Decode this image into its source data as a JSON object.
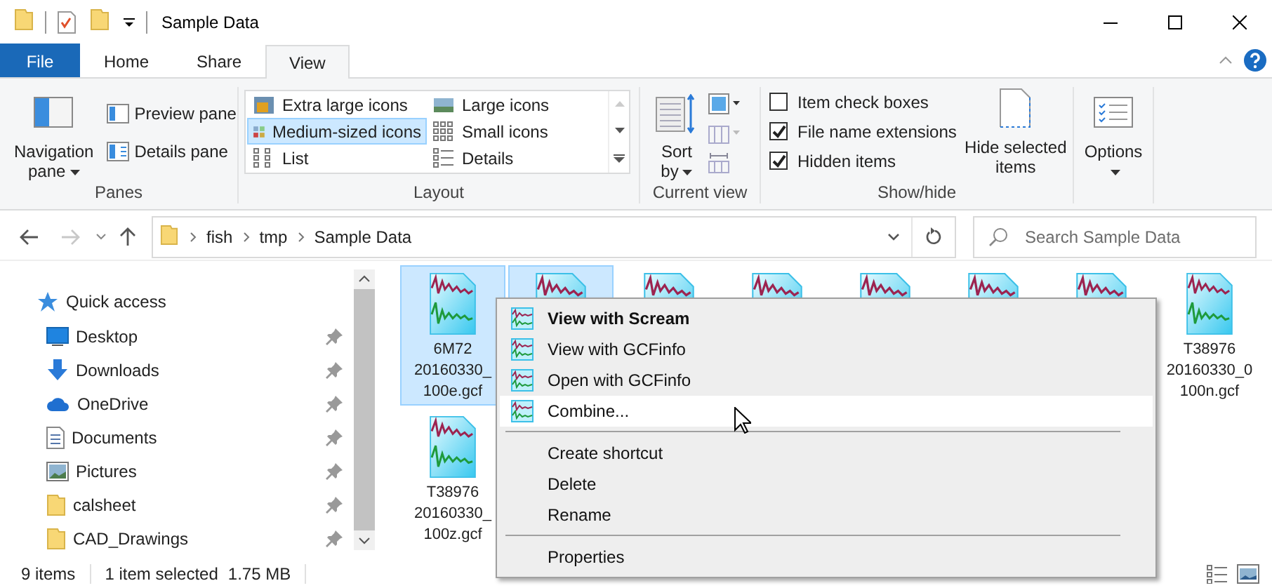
{
  "window": {
    "title": "Sample Data"
  },
  "ribbon_tabs": [
    {
      "label": "File",
      "kind": "file",
      "selected": false
    },
    {
      "label": "Home",
      "kind": "tab",
      "selected": false
    },
    {
      "label": "Share",
      "kind": "tab",
      "selected": false
    },
    {
      "label": "View",
      "kind": "tab",
      "selected": true
    }
  ],
  "panes": {
    "label": "Panes",
    "navigation_pane": "Navigation pane",
    "preview_pane": "Preview pane",
    "details_pane": "Details pane"
  },
  "layout": {
    "label": "Layout",
    "options": [
      {
        "label": "Extra large icons",
        "kind": "xl",
        "selected": false
      },
      {
        "label": "Large icons",
        "kind": "large",
        "selected": false
      },
      {
        "label": "Medium-sized icons",
        "kind": "medium",
        "selected": true
      },
      {
        "label": "Small icons",
        "kind": "small",
        "selected": false
      },
      {
        "label": "List",
        "kind": "list",
        "selected": false
      },
      {
        "label": "Details",
        "kind": "details",
        "selected": false
      }
    ]
  },
  "current_view": {
    "label": "Current view",
    "sort_by": "Sort by"
  },
  "show_hide": {
    "label": "Show/hide",
    "checkboxes": [
      {
        "label": "Item check boxes",
        "checked": false
      },
      {
        "label": "File name extensions",
        "checked": true
      },
      {
        "label": "Hidden items",
        "checked": true
      }
    ],
    "hide_selected": "Hide selected items"
  },
  "options": {
    "label": "Options"
  },
  "address": {
    "path": [
      "fish",
      "tmp",
      "Sample Data"
    ]
  },
  "search": {
    "placeholder": "Search Sample Data"
  },
  "navigation": [
    {
      "label": "Quick access",
      "kind": "quick",
      "pinned": false
    },
    {
      "label": "Desktop",
      "kind": "desktop",
      "pinned": true
    },
    {
      "label": "Downloads",
      "kind": "downloads",
      "pinned": true
    },
    {
      "label": "OneDrive",
      "kind": "cloud",
      "pinned": true
    },
    {
      "label": "Documents",
      "kind": "documents",
      "pinned": true
    },
    {
      "label": "Pictures",
      "kind": "pictures",
      "pinned": true
    },
    {
      "label": "calsheet",
      "kind": "folder",
      "pinned": true
    },
    {
      "label": "CAD_Drawings",
      "kind": "folder",
      "pinned": true
    }
  ],
  "files": [
    {
      "name_lines": [
        "6M72",
        "20160330_",
        "100e.gcf"
      ],
      "selected": true
    },
    {
      "selected": true
    },
    {
      "selected": false
    },
    {
      "selected": false
    },
    {
      "selected": false
    },
    {
      "selected": false
    },
    {
      "selected": false
    },
    {
      "name_lines": [
        "T38976",
        "20160330_0",
        "100n.gcf"
      ],
      "selected": false
    },
    {
      "name_lines": [
        "T38976",
        "20160330_",
        "100z.gcf"
      ],
      "selected": false
    }
  ],
  "context_menu": [
    {
      "kind": "app",
      "label": "View with Scream",
      "default": true,
      "selected": false
    },
    {
      "kind": "app",
      "label": "View with GCFinfo",
      "default": false,
      "selected": false
    },
    {
      "kind": "app",
      "label": "Open with GCFinfo",
      "default": false,
      "selected": false
    },
    {
      "kind": "app",
      "label": "Combine...",
      "default": false,
      "selected": true
    },
    {
      "kind": "separator"
    },
    {
      "kind": "shell",
      "label": "Create shortcut",
      "default": false,
      "selected": false
    },
    {
      "kind": "shell",
      "label": "Delete",
      "default": false,
      "selected": false
    },
    {
      "kind": "shell",
      "label": "Rename",
      "default": false,
      "selected": false
    },
    {
      "kind": "separator"
    },
    {
      "kind": "shell",
      "label": "Properties",
      "default": false,
      "selected": false
    }
  ],
  "status_bar": {
    "item_count": "9 items",
    "selection": "1 item selected",
    "size": "1.75 MB"
  }
}
